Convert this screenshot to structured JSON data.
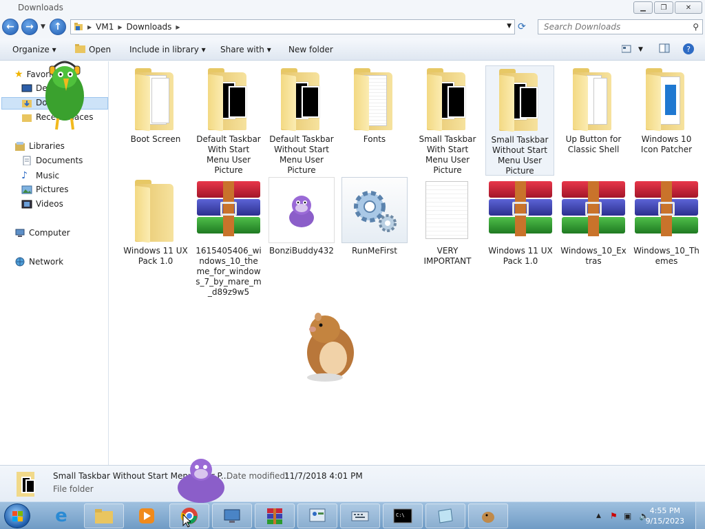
{
  "window": {
    "title": "Downloads",
    "controls": {
      "minimize": "▁",
      "maximize": "❐",
      "close": "✕"
    }
  },
  "address": {
    "crumbs": [
      "VM1",
      "Downloads"
    ],
    "search_placeholder": "Search Downloads"
  },
  "toolbar": {
    "organize": "Organize",
    "open": "Open",
    "include_in_library": "Include in library",
    "share_with": "Share with",
    "new_folder": "New folder"
  },
  "nav": {
    "favorites": "Favorites",
    "desktop": "Desktop",
    "downloads": "Downloads",
    "recent_places": "Recent Places",
    "libraries": "Libraries",
    "documents": "Documents",
    "music": "Music",
    "pictures": "Pictures",
    "videos": "Videos",
    "computer": "Computer",
    "network": "Network"
  },
  "items": [
    {
      "label": "Boot Screen",
      "kind": "folder-docs"
    },
    {
      "label": "Default Taskbar With Start Menu User Picture",
      "kind": "folder-black"
    },
    {
      "label": "Default Taskbar Without Start Menu User Picture",
      "kind": "folder-black"
    },
    {
      "label": "Fonts",
      "kind": "folder-docs"
    },
    {
      "label": "Small Taskbar With Start Menu User Picture",
      "kind": "folder-black"
    },
    {
      "label": "Small Taskbar Without Start Menu User Picture",
      "kind": "folder-black",
      "selected": true
    },
    {
      "label": "Up Button for Classic Shell",
      "kind": "folder-docs"
    },
    {
      "label": "Windows 10 Icon Patcher",
      "kind": "folder-blue"
    },
    {
      "label": "Windows 11 UX Pack 1.0",
      "kind": "folder-empty"
    },
    {
      "label": "1615405406_windows_10_theme_for_windows_7_by_mare_m_d89z9w5",
      "kind": "rar"
    },
    {
      "label": "BonziBuddy432",
      "kind": "bonzi"
    },
    {
      "label": "RunMeFirst",
      "kind": "gear"
    },
    {
      "label": "VERY IMPORTANT",
      "kind": "textfile"
    },
    {
      "label": "Windows 11 UX Pack 1.0",
      "kind": "rar"
    },
    {
      "label": "Windows_10_Extras",
      "kind": "rar"
    },
    {
      "label": "Windows_10_Themes",
      "kind": "rar"
    }
  ],
  "details": {
    "name": "Small Taskbar Without Start Menu User P...",
    "type": "File folder",
    "modified_label": "Date modified:",
    "modified": "11/7/2018 4:01 PM"
  },
  "taskbar": {
    "time": "4:55 PM",
    "date": "9/15/2023",
    "apps": [
      "internet-explorer",
      "file-explorer",
      "media-player",
      "chrome",
      "remote-desktop",
      "winrar",
      "control-panel",
      "on-screen-keyboard",
      "command-prompt",
      "notepad",
      "bonzi-app"
    ]
  }
}
